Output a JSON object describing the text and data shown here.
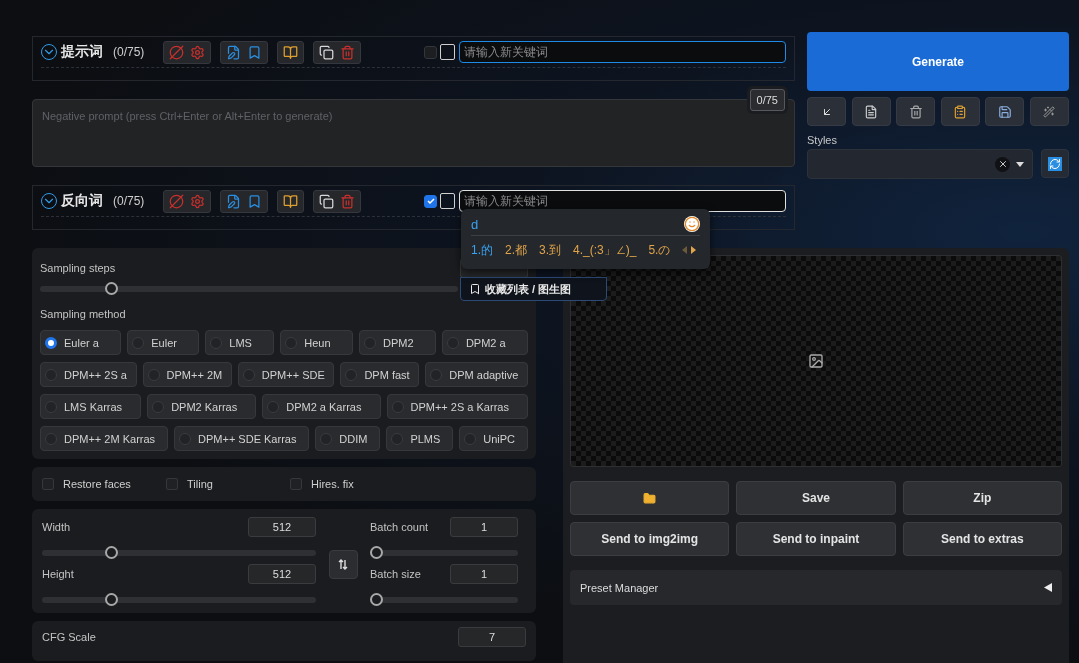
{
  "prompt_rows": [
    {
      "title": "提示词",
      "count": "(0/75)",
      "checked": false,
      "focused": false,
      "placeholder": "请输入新关键词"
    },
    {
      "title": "反向词",
      "count": "(0/75)",
      "checked": true,
      "focused": true,
      "placeholder": "请输入新关键词"
    }
  ],
  "negative_prompt": {
    "placeholder": "Negative prompt (press Ctrl+Enter or Alt+Enter to generate)",
    "token_count": "0/75"
  },
  "ime": {
    "typed": "d",
    "candidates": [
      {
        "text": "1.的",
        "selected": true
      },
      {
        "text": "2.都",
        "selected": false
      },
      {
        "text": "3.到",
        "selected": false
      },
      {
        "text": "4._(:3」∠)_",
        "selected": false
      },
      {
        "text": "5.の",
        "selected": false
      }
    ]
  },
  "tooltip": "收藏列表 / 图生图",
  "generate": "Generate",
  "styles": {
    "label": "Styles"
  },
  "sampling_steps": {
    "label": "Sampling steps",
    "level": 0.16
  },
  "sampling_method": {
    "label": "Sampling method",
    "options": [
      {
        "label": "Euler a",
        "selected": true
      },
      {
        "label": "Euler",
        "selected": false
      },
      {
        "label": "LMS",
        "selected": false
      },
      {
        "label": "Heun",
        "selected": false
      },
      {
        "label": "DPM2",
        "selected": false
      },
      {
        "label": "DPM2 a",
        "selected": false
      },
      {
        "label": "DPM++ 2S a",
        "selected": false
      },
      {
        "label": "DPM++ 2M",
        "selected": false
      },
      {
        "label": "DPM++ SDE",
        "selected": false
      },
      {
        "label": "DPM fast",
        "selected": false
      },
      {
        "label": "DPM adaptive",
        "selected": false
      },
      {
        "label": "LMS Karras",
        "selected": false
      },
      {
        "label": "DPM2 Karras",
        "selected": false
      },
      {
        "label": "DPM2 a Karras",
        "selected": false
      },
      {
        "label": "DPM++ 2S a Karras",
        "selected": false
      },
      {
        "label": "DPM++ 2M Karras",
        "selected": false
      },
      {
        "label": "DPM++ SDE Karras",
        "selected": false
      },
      {
        "label": "DDIM",
        "selected": false
      },
      {
        "label": "PLMS",
        "selected": false
      },
      {
        "label": "UniPC",
        "selected": false
      }
    ]
  },
  "options": [
    {
      "label": "Restore faces",
      "checked": false
    },
    {
      "label": "Tiling",
      "checked": false
    },
    {
      "label": "Hires. fix",
      "checked": false
    }
  ],
  "size": [
    {
      "label": "Width",
      "value": "512",
      "level": 0.24
    },
    {
      "label": "Height",
      "value": "512",
      "level": 0.24
    }
  ],
  "batch": [
    {
      "label": "Batch count",
      "value": "1",
      "level": 0
    },
    {
      "label": "Batch size",
      "value": "1",
      "level": 0
    }
  ],
  "cfg": {
    "label": "CFG Scale",
    "value": "7"
  },
  "output_buttons": [
    [
      {
        "kind": "folder"
      },
      {
        "kind": "text",
        "label": "Save"
      },
      {
        "kind": "text",
        "label": "Zip"
      }
    ],
    [
      {
        "kind": "text",
        "label": "Send to img2img"
      },
      {
        "kind": "text",
        "label": "Send to inpaint"
      },
      {
        "kind": "text",
        "label": "Send to extras"
      }
    ]
  ],
  "preset_manager": {
    "label": "Preset Manager",
    "expanded": false
  }
}
